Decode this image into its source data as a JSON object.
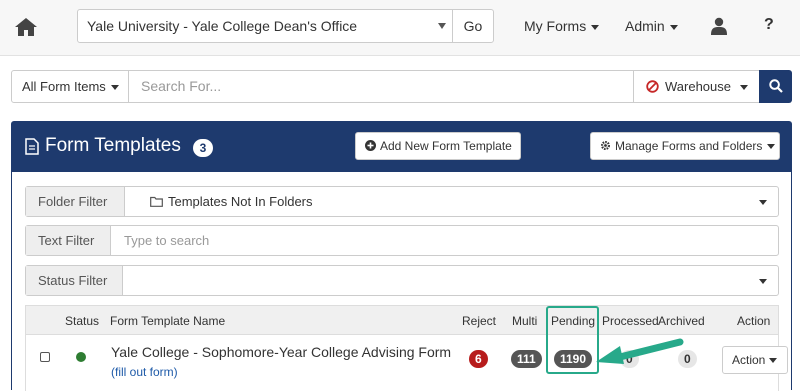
{
  "nav": {
    "org_selected": "Yale University - Yale College Dean's Office",
    "go_label": "Go",
    "my_forms_label": "My Forms",
    "admin_label": "Admin",
    "help_label": "?"
  },
  "search": {
    "filter_label": "All Form Items",
    "placeholder": "Search For...",
    "warehouse_label": "Warehouse"
  },
  "panel": {
    "title": "Form Templates",
    "count": "3",
    "add_label": "Add New Form Template",
    "manage_label": "Manage Forms and Folders"
  },
  "filters": {
    "folder_label": "Folder Filter",
    "folder_value": "Templates Not In Folders",
    "text_label": "Text Filter",
    "text_placeholder": "Type to search",
    "status_label": "Status Filter",
    "status_value": ""
  },
  "table": {
    "headers": {
      "status": "Status",
      "name": "Form Template Name",
      "reject": "Reject",
      "multi": "Multi",
      "pending": "Pending",
      "processed": "Processed",
      "archived": "Archived",
      "action": "Action"
    },
    "rows": [
      {
        "name": "Yale College - Sophomore-Year College Advising Form",
        "link": "(fill out form)",
        "reject": "6",
        "multi": "111",
        "pending": "1190",
        "processed": "0",
        "archived": "0",
        "action_label": "Action"
      }
    ]
  },
  "colors": {
    "primary": "#1e3a6e",
    "reject_badge": "#b71c1c",
    "highlight": "#27a98a",
    "status_active": "#2e7d32"
  },
  "icons": [
    "home-icon",
    "user-icon",
    "ban-icon",
    "search-icon",
    "document-icon",
    "plus-circle-icon",
    "gear-icon",
    "folder-icon"
  ]
}
